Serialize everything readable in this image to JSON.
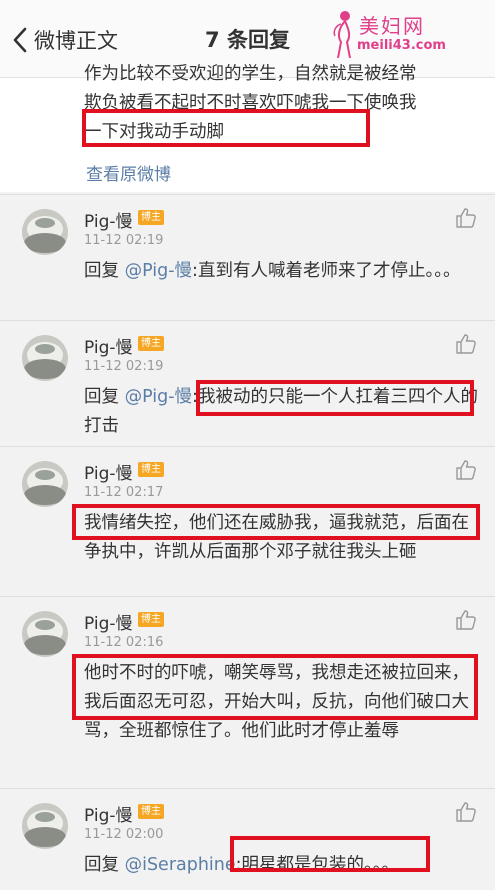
{
  "header": {
    "back_label": "微博正文",
    "title": "7 条回复"
  },
  "watermark": {
    "title": "美妇网",
    "url": "meili43.com"
  },
  "original": {
    "lines": [
      "作为比较不受欢迎的学生，自然就是被经常",
      "欺负被看不起时不时喜欢吓唬我一下使唤我",
      "一下对我动手动脚"
    ],
    "view_link": "查看原微博"
  },
  "comments": [
    {
      "name": "Pig-慢",
      "badge": "博主",
      "time": "11-12 02:19",
      "prefix": "回复 ",
      "mention": "@Pig-慢",
      "text": ":直到有人喊着老师来了才停止。。。"
    },
    {
      "name": "Pig-慢",
      "badge": "博主",
      "time": "11-12 02:19",
      "prefix": "回复 ",
      "mention": "@Pig-慢",
      "text": ":我被动的只能一个人扛着三四个人的打击"
    },
    {
      "name": "Pig-慢",
      "badge": "博主",
      "time": "11-12 02:17",
      "prefix": "",
      "mention": "",
      "text": "我情绪失控，他们还在威胁我，逼我就范，后面在争执中，许凯从后面那个邓子就往我头上砸"
    },
    {
      "name": "Pig-慢",
      "badge": "博主",
      "time": "11-12 02:16",
      "prefix": "",
      "mention": "",
      "text": "他时不时的吓唬，嘲笑辱骂，我想走还被拉回来，我后面忍无可忍，开始大叫，反抗，向他们破口大骂，全班都惊住了。他们此时才停止羞辱"
    },
    {
      "name": "Pig-慢",
      "badge": "博主",
      "time": "11-12 02:00",
      "prefix": "回复 ",
      "mention": "@iSeraphine",
      "text": ":明星都是包装的。。。"
    }
  ],
  "colors": {
    "highlight": "#e0101e",
    "mention": "#5b7ea6",
    "badge": "#f5a623",
    "watermark": "#e0408a"
  }
}
